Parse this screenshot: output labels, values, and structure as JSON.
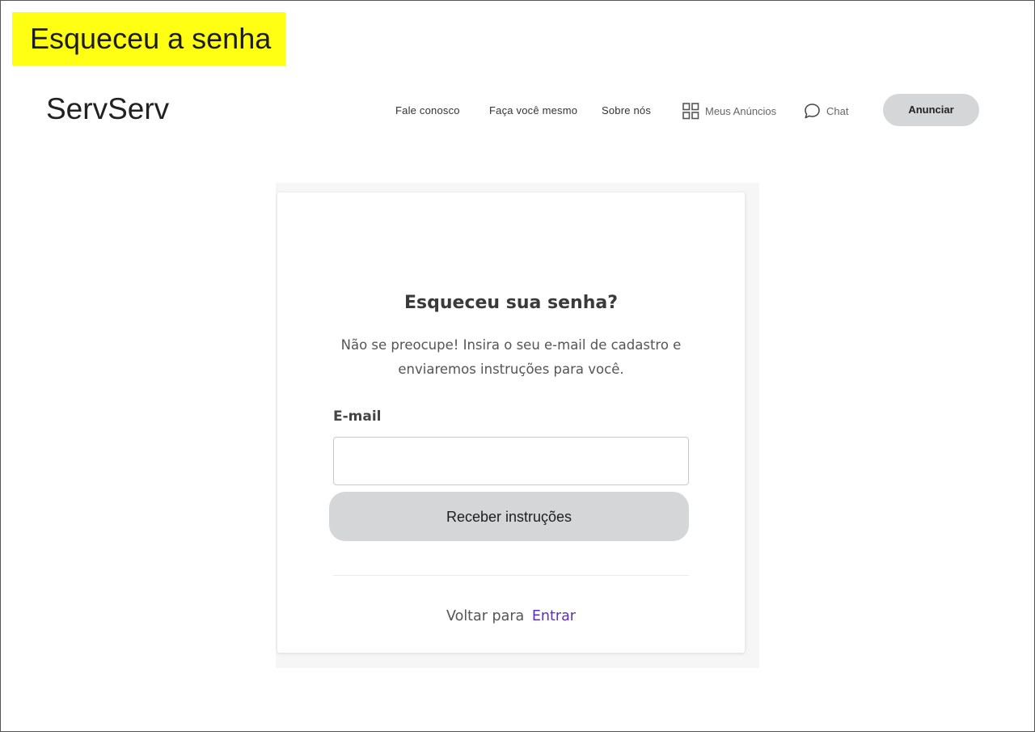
{
  "page_tag": "Esqueceu a senha",
  "header": {
    "logo": "ServServ",
    "nav": {
      "fale_conosco": "Fale conosco",
      "faca_voce_mesmo": "Faça você mesmo",
      "sobre_nos": "Sobre nós",
      "meus_anuncios": "Meus Anúncios",
      "chat": "Chat"
    },
    "anunciar_label": "Anunciar"
  },
  "form": {
    "title": "Esqueceu sua senha?",
    "description": "Não se preocupe! Insira o seu e-mail de cadastro e enviaremos instruções para você.",
    "email_label": "E-mail",
    "email_value": "",
    "email_placeholder": "",
    "submit_label": "Receber instruções",
    "back_text": "Voltar para",
    "back_link": "Entrar"
  },
  "colors": {
    "tag_background": "#ffff14",
    "button_background": "#d5d6d8",
    "link": "#5a2fc1"
  },
  "icons": {
    "meus_anuncios": "grid-icon",
    "chat": "chat-bubble-icon"
  }
}
